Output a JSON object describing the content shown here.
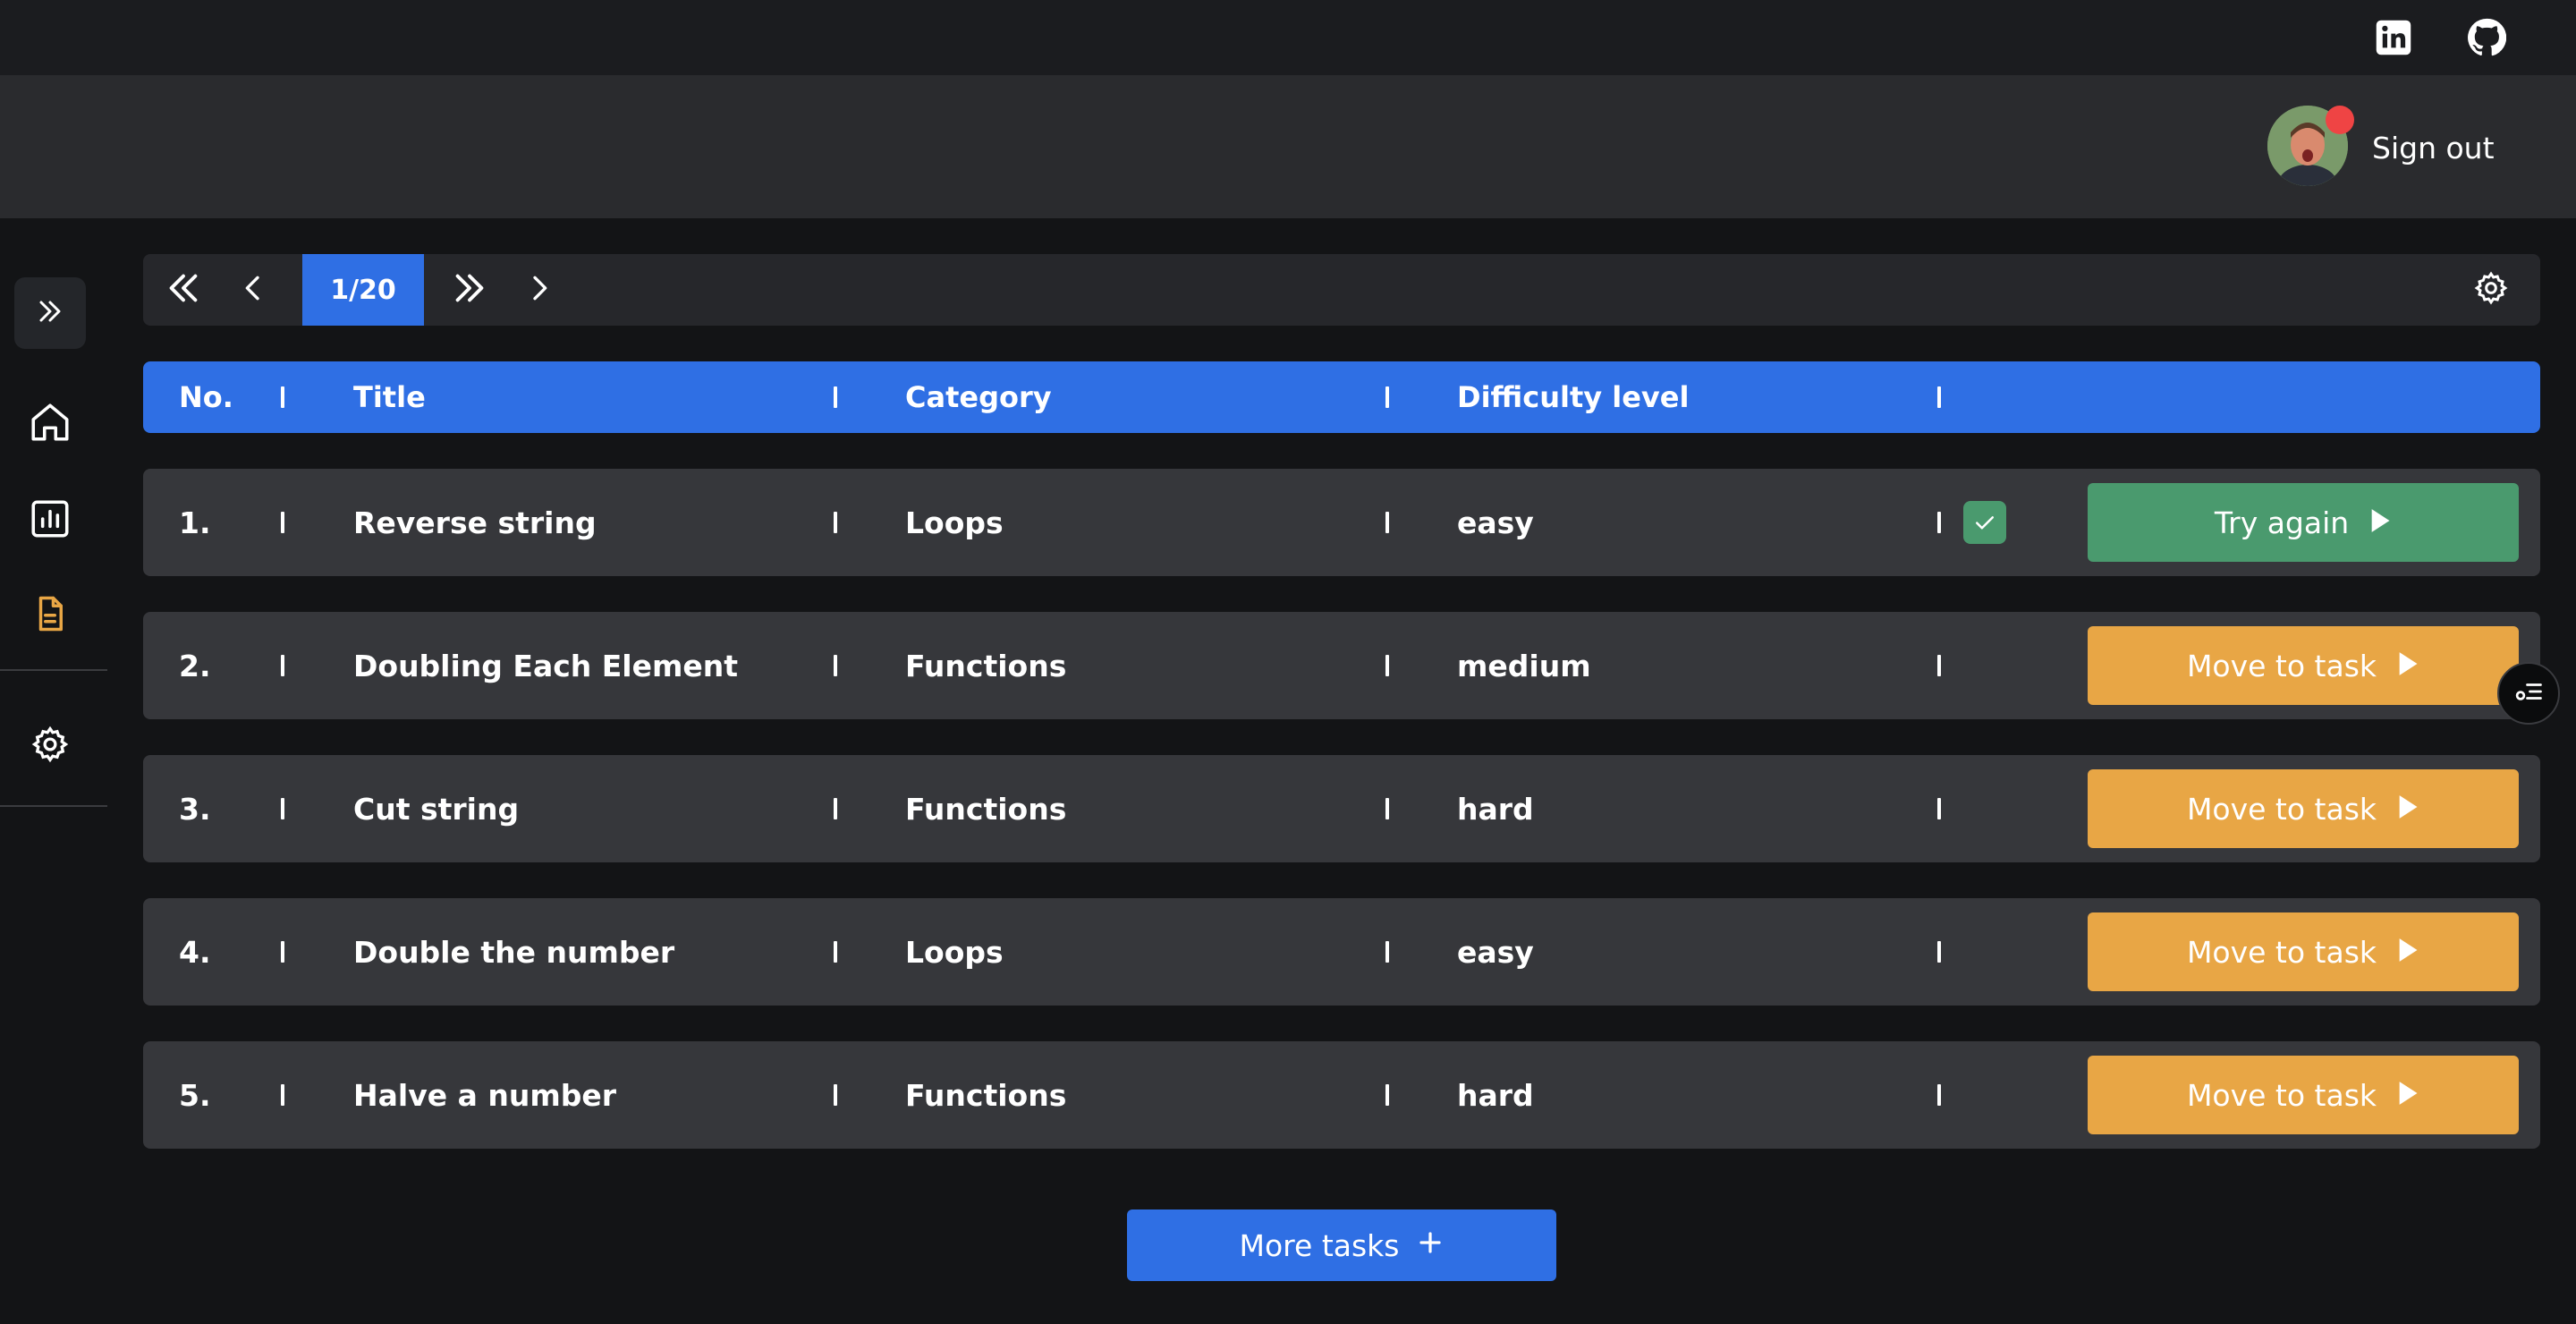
{
  "topbar": {
    "icons": [
      "linkedin-icon",
      "github-icon"
    ]
  },
  "header": {
    "sign_out_label": "Sign out",
    "avatar_icon": "user-avatar"
  },
  "sidebar": {
    "items": [
      {
        "icon": "double-chevron-right-icon"
      },
      {
        "icon": "home-icon"
      },
      {
        "icon": "chart-icon"
      },
      {
        "icon": "document-icon",
        "active": true
      },
      {
        "icon": "gear-icon"
      }
    ]
  },
  "pagination": {
    "indicator": "1/20"
  },
  "table": {
    "columns": [
      "No.",
      "Title",
      "Category",
      "Difficulty level"
    ],
    "rows": [
      {
        "no": "1.",
        "title": "Reverse string",
        "category": "Loops",
        "difficulty": "easy",
        "completed": true,
        "action": "Try again"
      },
      {
        "no": "2.",
        "title": "Doubling Each Element",
        "category": "Functions",
        "difficulty": "medium",
        "completed": false,
        "action": "Move to task"
      },
      {
        "no": "3.",
        "title": "Cut string",
        "category": "Functions",
        "difficulty": "hard",
        "completed": false,
        "action": "Move to task"
      },
      {
        "no": "4.",
        "title": "Double the number",
        "category": "Loops",
        "difficulty": "easy",
        "completed": false,
        "action": "Move to task"
      },
      {
        "no": "5.",
        "title": "Halve a number",
        "category": "Functions",
        "difficulty": "hard",
        "completed": false,
        "action": "Move to task"
      }
    ]
  },
  "more_tasks_label": "More tasks",
  "colors": {
    "primary": "#2f6fe4",
    "success": "#4a9a6e",
    "warning": "#e8a645",
    "active_icon": "#e8a645"
  }
}
